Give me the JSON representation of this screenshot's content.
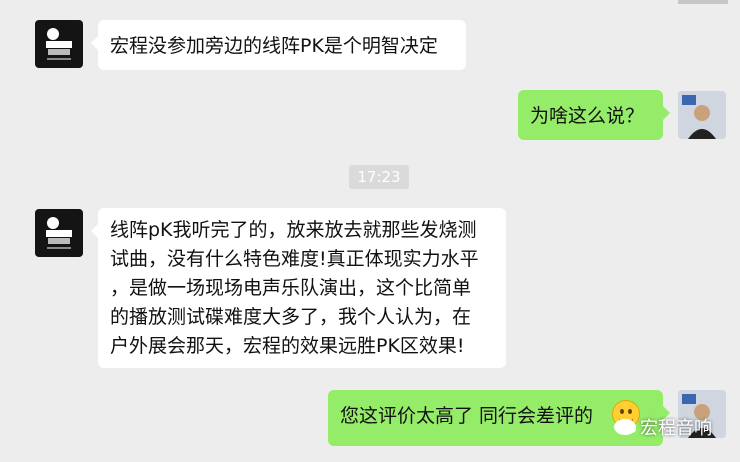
{
  "chat": {
    "messages": [
      {
        "side": "left",
        "text": "宏程没参加旁边的线阵PK是个明智决定"
      },
      {
        "side": "right",
        "text": "为啥这么说？"
      },
      {
        "side": "left",
        "lines": [
          "线阵pK我听完了的，放来放去就那些发烧测",
          "试曲，没有什么特色难度!真正体现实力水平",
          "，是做一场现场电声乐队演出，这个比简单",
          "的播放测试碟难度大多了，我个人认为，在",
          "户外展会那天，宏程的效果远胜PK区效果!"
        ]
      },
      {
        "side": "right",
        "text": "您这评价太高了  同行会差评的"
      }
    ],
    "timestamp": "17:23"
  },
  "watermark": {
    "text": "宏程音响"
  },
  "colors": {
    "background": "#ededed",
    "bubble_right": "#95ec69",
    "bubble_left": "#ffffff"
  },
  "icons": {
    "emoji": "grin-emoji",
    "watermark": "wechat-icon"
  }
}
